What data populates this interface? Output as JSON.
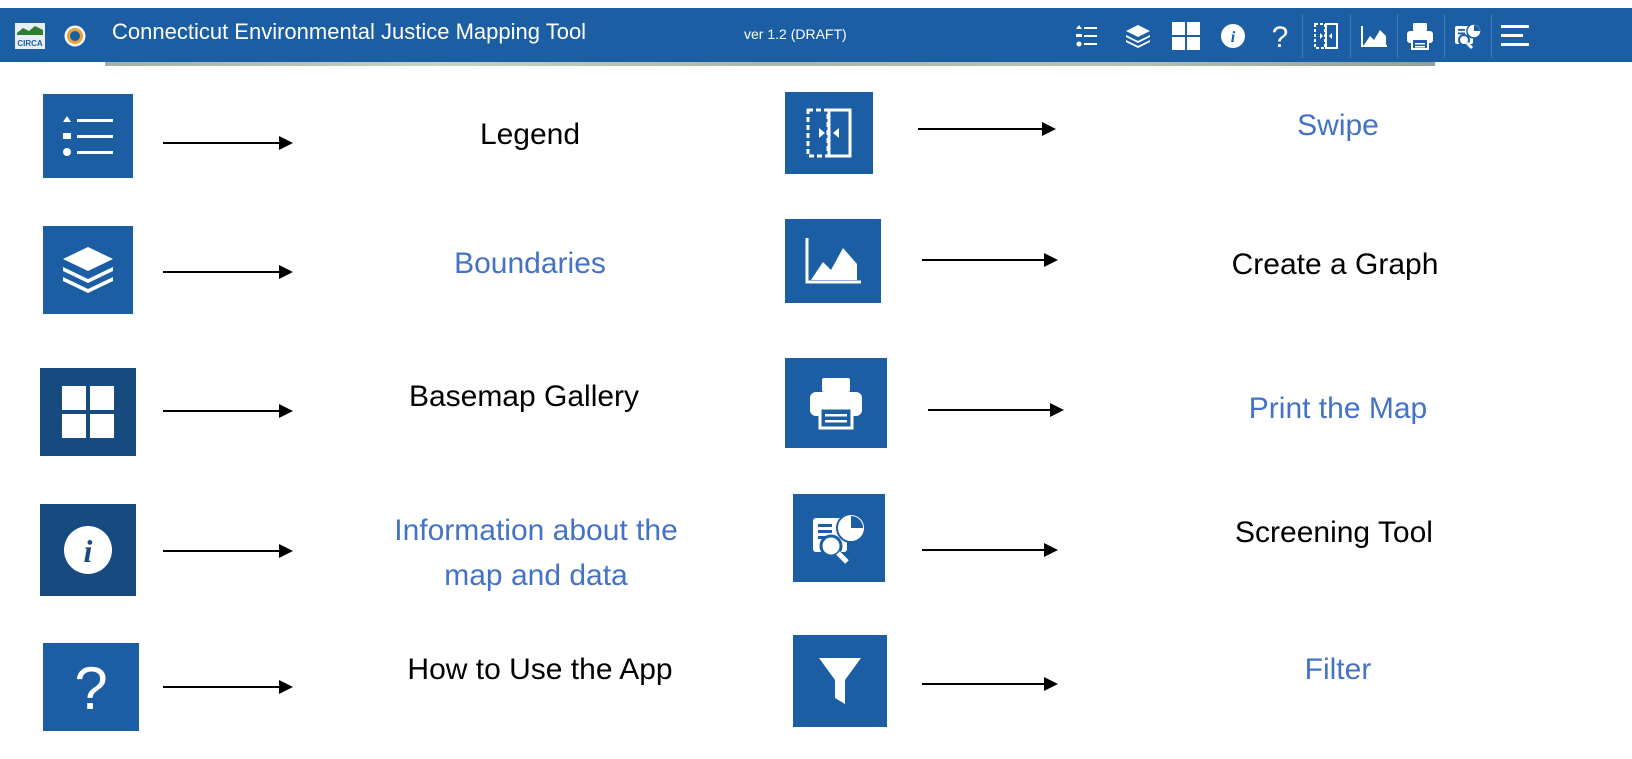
{
  "header": {
    "logo_text": "CIRCA",
    "title": "Connecticut Environmental Justice Mapping Tool",
    "version": "ver 1.2 (DRAFT)",
    "toolbar_icons": [
      "legend-icon",
      "layers-icon",
      "basemap-gallery-icon",
      "info-icon",
      "help-icon",
      "swipe-icon",
      "graph-icon",
      "print-icon",
      "screening-icon",
      "menu-icon"
    ]
  },
  "items": [
    {
      "icon": "legend-icon",
      "label": "Legend",
      "color": "#000000"
    },
    {
      "icon": "layers-icon",
      "label": "Boundaries",
      "color": "#4472c4"
    },
    {
      "icon": "basemap-gallery-icon",
      "label": "Basemap Gallery",
      "color": "#000000"
    },
    {
      "icon": "info-icon",
      "label_line1": "Information about the",
      "label_line2": "map and data",
      "color": "#4472c4"
    },
    {
      "icon": "help-icon",
      "label": "How to Use the App",
      "color": "#000000"
    },
    {
      "icon": "swipe-icon",
      "label": "Swipe",
      "color": "#4472c4"
    },
    {
      "icon": "graph-icon",
      "label": "Create a Graph",
      "color": "#000000"
    },
    {
      "icon": "print-icon",
      "label": "Print the Map",
      "color": "#4472c4"
    },
    {
      "icon": "screening-icon",
      "label": "Screening Tool",
      "color": "#000000"
    },
    {
      "icon": "filter-icon",
      "label": "Filter",
      "color": "#4472c4"
    }
  ],
  "colors": {
    "header": "#1c5ea3",
    "tile": "#1c5ea3",
    "tile_dark": "#174b80",
    "label_blue": "#4472c4"
  }
}
